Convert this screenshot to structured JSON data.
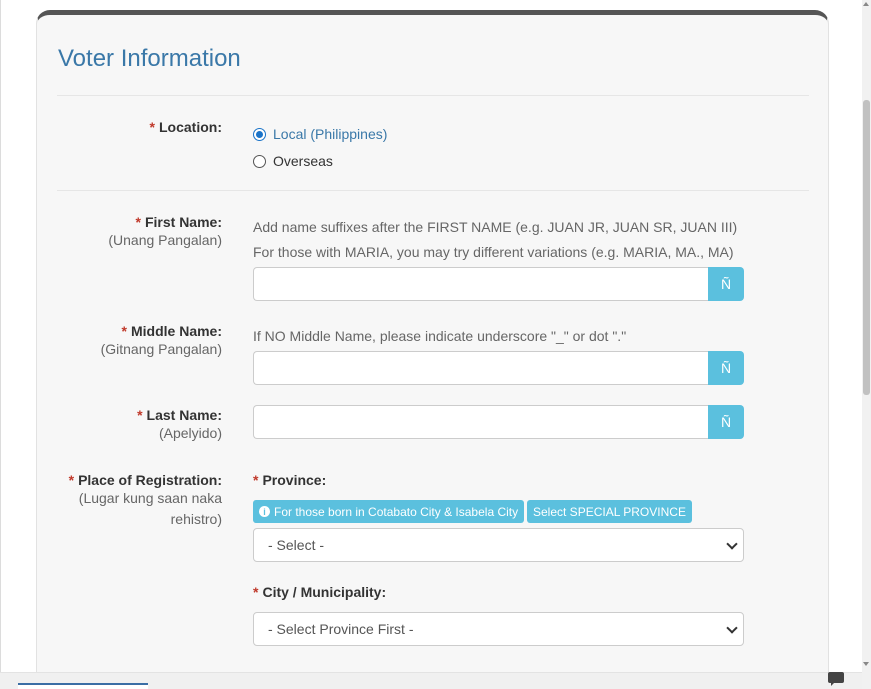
{
  "form": {
    "title": "Voter Information",
    "required_marker": "*",
    "location": {
      "label": "Location:",
      "options": [
        {
          "label": "Local (Philippines)",
          "checked": true
        },
        {
          "label": "Overseas",
          "checked": false
        }
      ]
    },
    "first_name": {
      "label": "First Name:",
      "sublabel": "(Unang Pangalan)",
      "hint1": "Add name suffixes after the FIRST NAME (e.g. JUAN JR, JUAN SR, JUAN III)",
      "hint2": "For those with MARIA, you may try different variations (e.g. MARIA, MA., MA)",
      "value": "",
      "enye_button": "Ñ"
    },
    "middle_name": {
      "label": "Middle Name:",
      "sublabel": "(Gitnang Pangalan)",
      "hint": "If NO Middle Name, please indicate underscore \"_\" or dot \".\"",
      "value": "",
      "enye_button": "Ñ"
    },
    "last_name": {
      "label": "Last Name:",
      "sublabel": "(Apelyido)",
      "value": "",
      "enye_button": "Ñ"
    },
    "place_of_registration": {
      "label": "Place of Registration:",
      "sublabel_line1": "(Lugar kung saan naka",
      "sublabel_line2": "rehistro)",
      "province": {
        "label": "Province:",
        "info_badge": "For those born in Cotabato City & Isabela City",
        "special_badge": "Select SPECIAL PROVINCE",
        "selected": "- Select -"
      },
      "city": {
        "label": "City / Municipality:",
        "selected": "- Select Province First -"
      }
    }
  },
  "colors": {
    "title": "#3a78a8",
    "info": "#5bc0de",
    "required": "#c0392b"
  }
}
